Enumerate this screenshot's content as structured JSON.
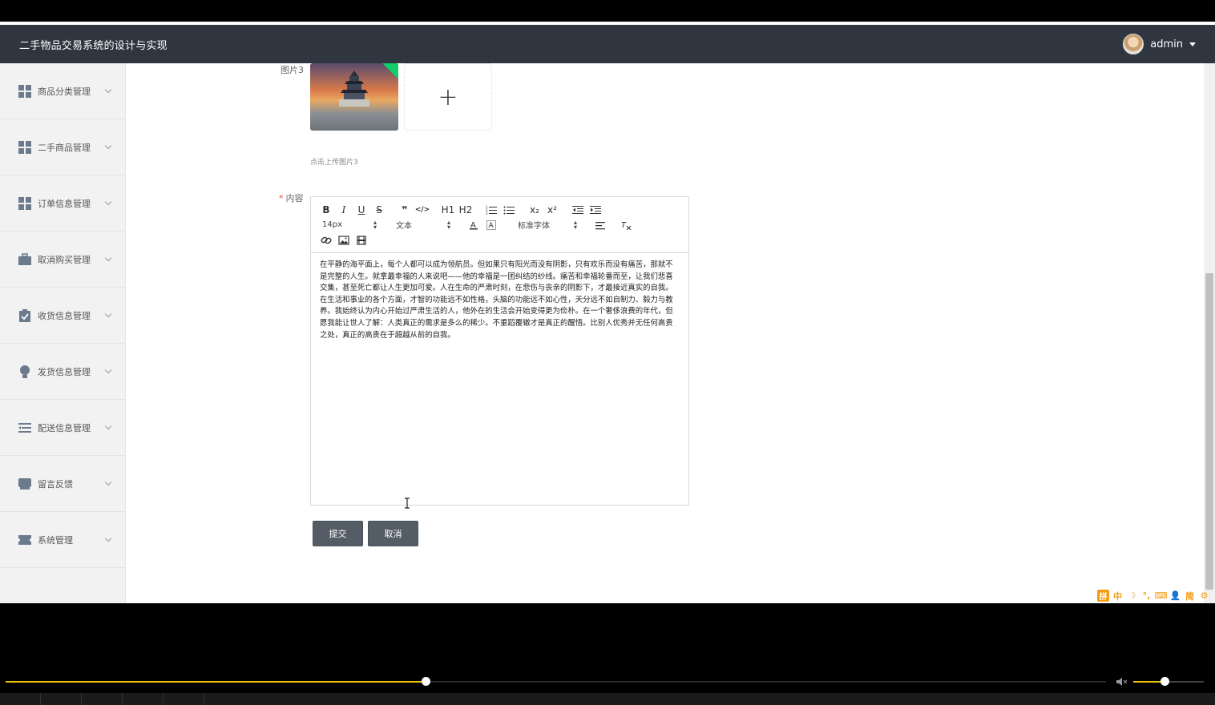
{
  "header": {
    "title": "二手物品交易系统的设计与实现",
    "username": "admin"
  },
  "sidebar": {
    "items": [
      {
        "label": "商品分类管理",
        "icon": "grid-icon"
      },
      {
        "label": "二手商品管理",
        "icon": "grid-icon"
      },
      {
        "label": "订单信息管理",
        "icon": "grid-icon"
      },
      {
        "label": "取消购买管理",
        "icon": "briefcase-icon"
      },
      {
        "label": "收货信息管理",
        "icon": "clipboard-check-icon"
      },
      {
        "label": "发货信息管理",
        "icon": "lightbulb-icon"
      },
      {
        "label": "配送信息管理",
        "icon": "list-icon"
      },
      {
        "label": "留言反馈",
        "icon": "inbox-icon"
      },
      {
        "label": "系统管理",
        "icon": "ticket-icon"
      }
    ]
  },
  "form": {
    "image3_label": "图片3",
    "upload_hint": "点击上传图片3",
    "upload_plus": "+",
    "content_label": "内容",
    "required_mark": "*",
    "editor": {
      "font_size": "14px",
      "text_type": "文本",
      "font_family": "标准字体",
      "toolbar_row1": [
        "B",
        "I",
        "U",
        "S",
        "❞",
        "</>",
        "H1",
        "H2",
        "ordered-list",
        "bullet-list",
        "x₂",
        "x²",
        "outdent",
        "indent"
      ],
      "content": "在平静的海平面上，每个人都可以成为领航员。但如果只有阳光而没有阴影，只有欢乐而没有痛苦，那就不是完整的人生。就拿最幸福的人来说吧——他的幸福是一团纠结的纱线。痛苦和幸福轮番而至，让我们悲喜交集，甚至死亡都让人生更加可爱。人在生命的严肃时刻，在悲伤与丧亲的阴影下，才最接近真实的自我。在生活和事业的各个方面，才智的功能远不如性格，头脑的功能远不如心性，天分远不如自制力、毅力与教养。我始终认为内心开始过严肃生活的人，他外在的生活会开始变得更为俭朴。在一个奢侈浪费的年代，但愿我能让世人了解：人类真正的需求是多么的稀少。不重蹈覆辙才是真正的醒悟。比别人优秀并无任何高贵之处，真正的高贵在于超越从前的自我。"
    },
    "submit_label": "提交",
    "cancel_label": "取消"
  },
  "ime_bar": [
    "拼",
    "中",
    "☽",
    "°,",
    "⌨",
    "👤",
    "简",
    "⚙"
  ],
  "player": {
    "progress": 0.382,
    "volume": 0.445,
    "accent": "#f1c40f"
  }
}
